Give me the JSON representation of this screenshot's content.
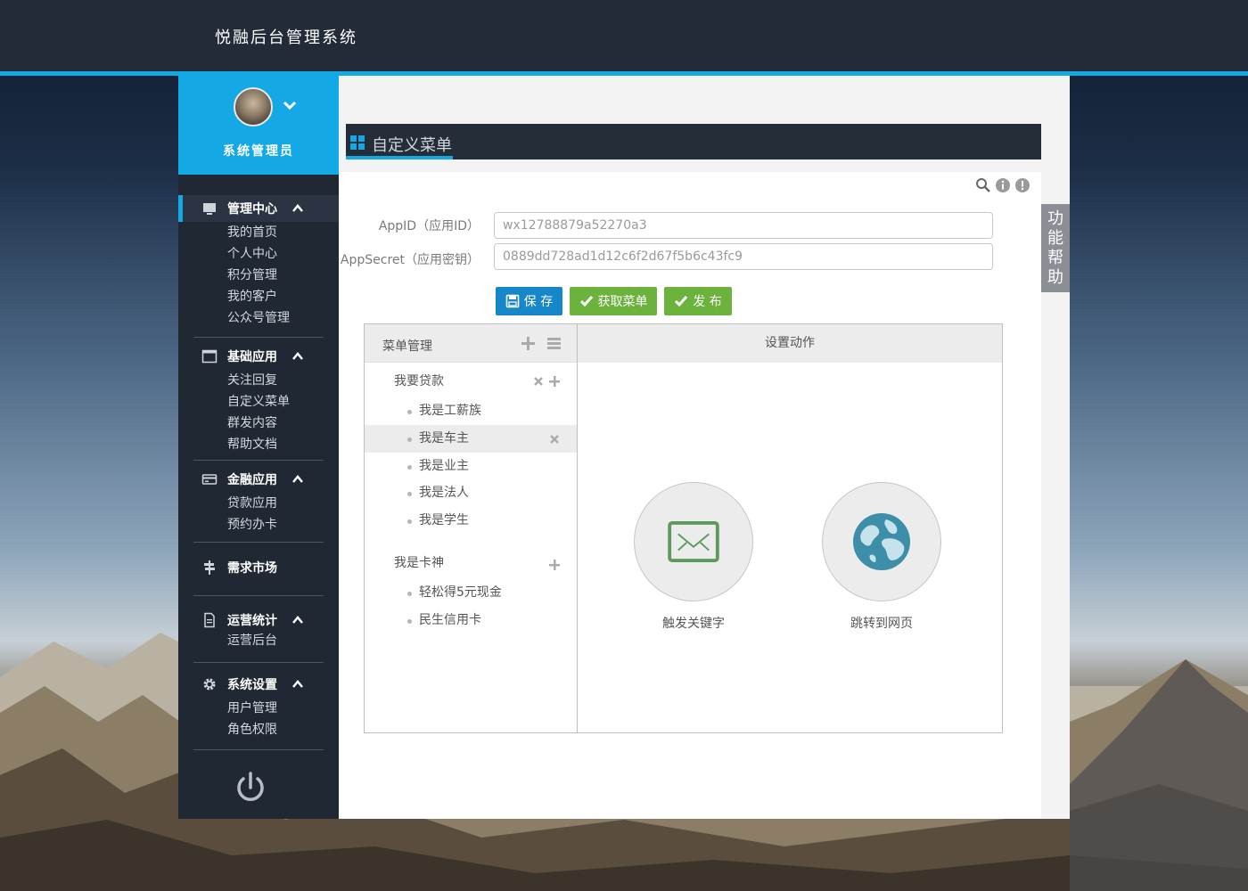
{
  "app": {
    "title": "悦融后台管理系统"
  },
  "profile": {
    "name": "系统管理员"
  },
  "sidebar": {
    "groups": [
      {
        "label": "管理中心",
        "items": [
          "我的首页",
          "个人中心",
          "积分管理",
          "我的客户",
          "公众号管理"
        ]
      },
      {
        "label": "基础应用",
        "items": [
          "关注回复",
          "自定义菜单",
          "群发内容",
          "帮助文档"
        ]
      },
      {
        "label": "金融应用",
        "items": [
          "贷款应用",
          "预约办卡"
        ]
      },
      {
        "label": "需求市场",
        "items": []
      },
      {
        "label": "运营统计",
        "items": [
          "运营后台"
        ]
      },
      {
        "label": "系统设置",
        "items": [
          "用户管理",
          "角色权限"
        ]
      }
    ]
  },
  "page": {
    "title": "自定义菜单",
    "help_tab": "功能帮助"
  },
  "form": {
    "appid_label": "AppID（应用ID）",
    "appid_value": "wx12788879a52270a3",
    "secret_label": "AppSecret（应用密钥）",
    "secret_value": "0889dd728ad1d12c6f2d67f5b6c43fc9"
  },
  "buttons": {
    "save": "保 存",
    "fetch": "获取菜单",
    "publish": "发 布"
  },
  "menu_panel": {
    "left_title": "菜单管理",
    "right_title": "设置动作",
    "menus": [
      {
        "label": "我要贷款",
        "children": [
          "我是工薪族",
          "我是车主",
          "我是业主",
          "我是法人",
          "我是学生"
        ]
      },
      {
        "label": "我是卡神",
        "children": [
          "轻松得5元现金",
          "民生信用卡"
        ]
      }
    ],
    "actions": [
      {
        "label": "触发关键字",
        "icon": "envelope-icon"
      },
      {
        "label": "跳转到网页",
        "icon": "globe-icon"
      }
    ]
  },
  "colors": {
    "accent": "#14a8e4",
    "topbar": "#232b38",
    "sidebar": "#202833",
    "green": "#6cb33e",
    "blue": "#1687c9"
  }
}
